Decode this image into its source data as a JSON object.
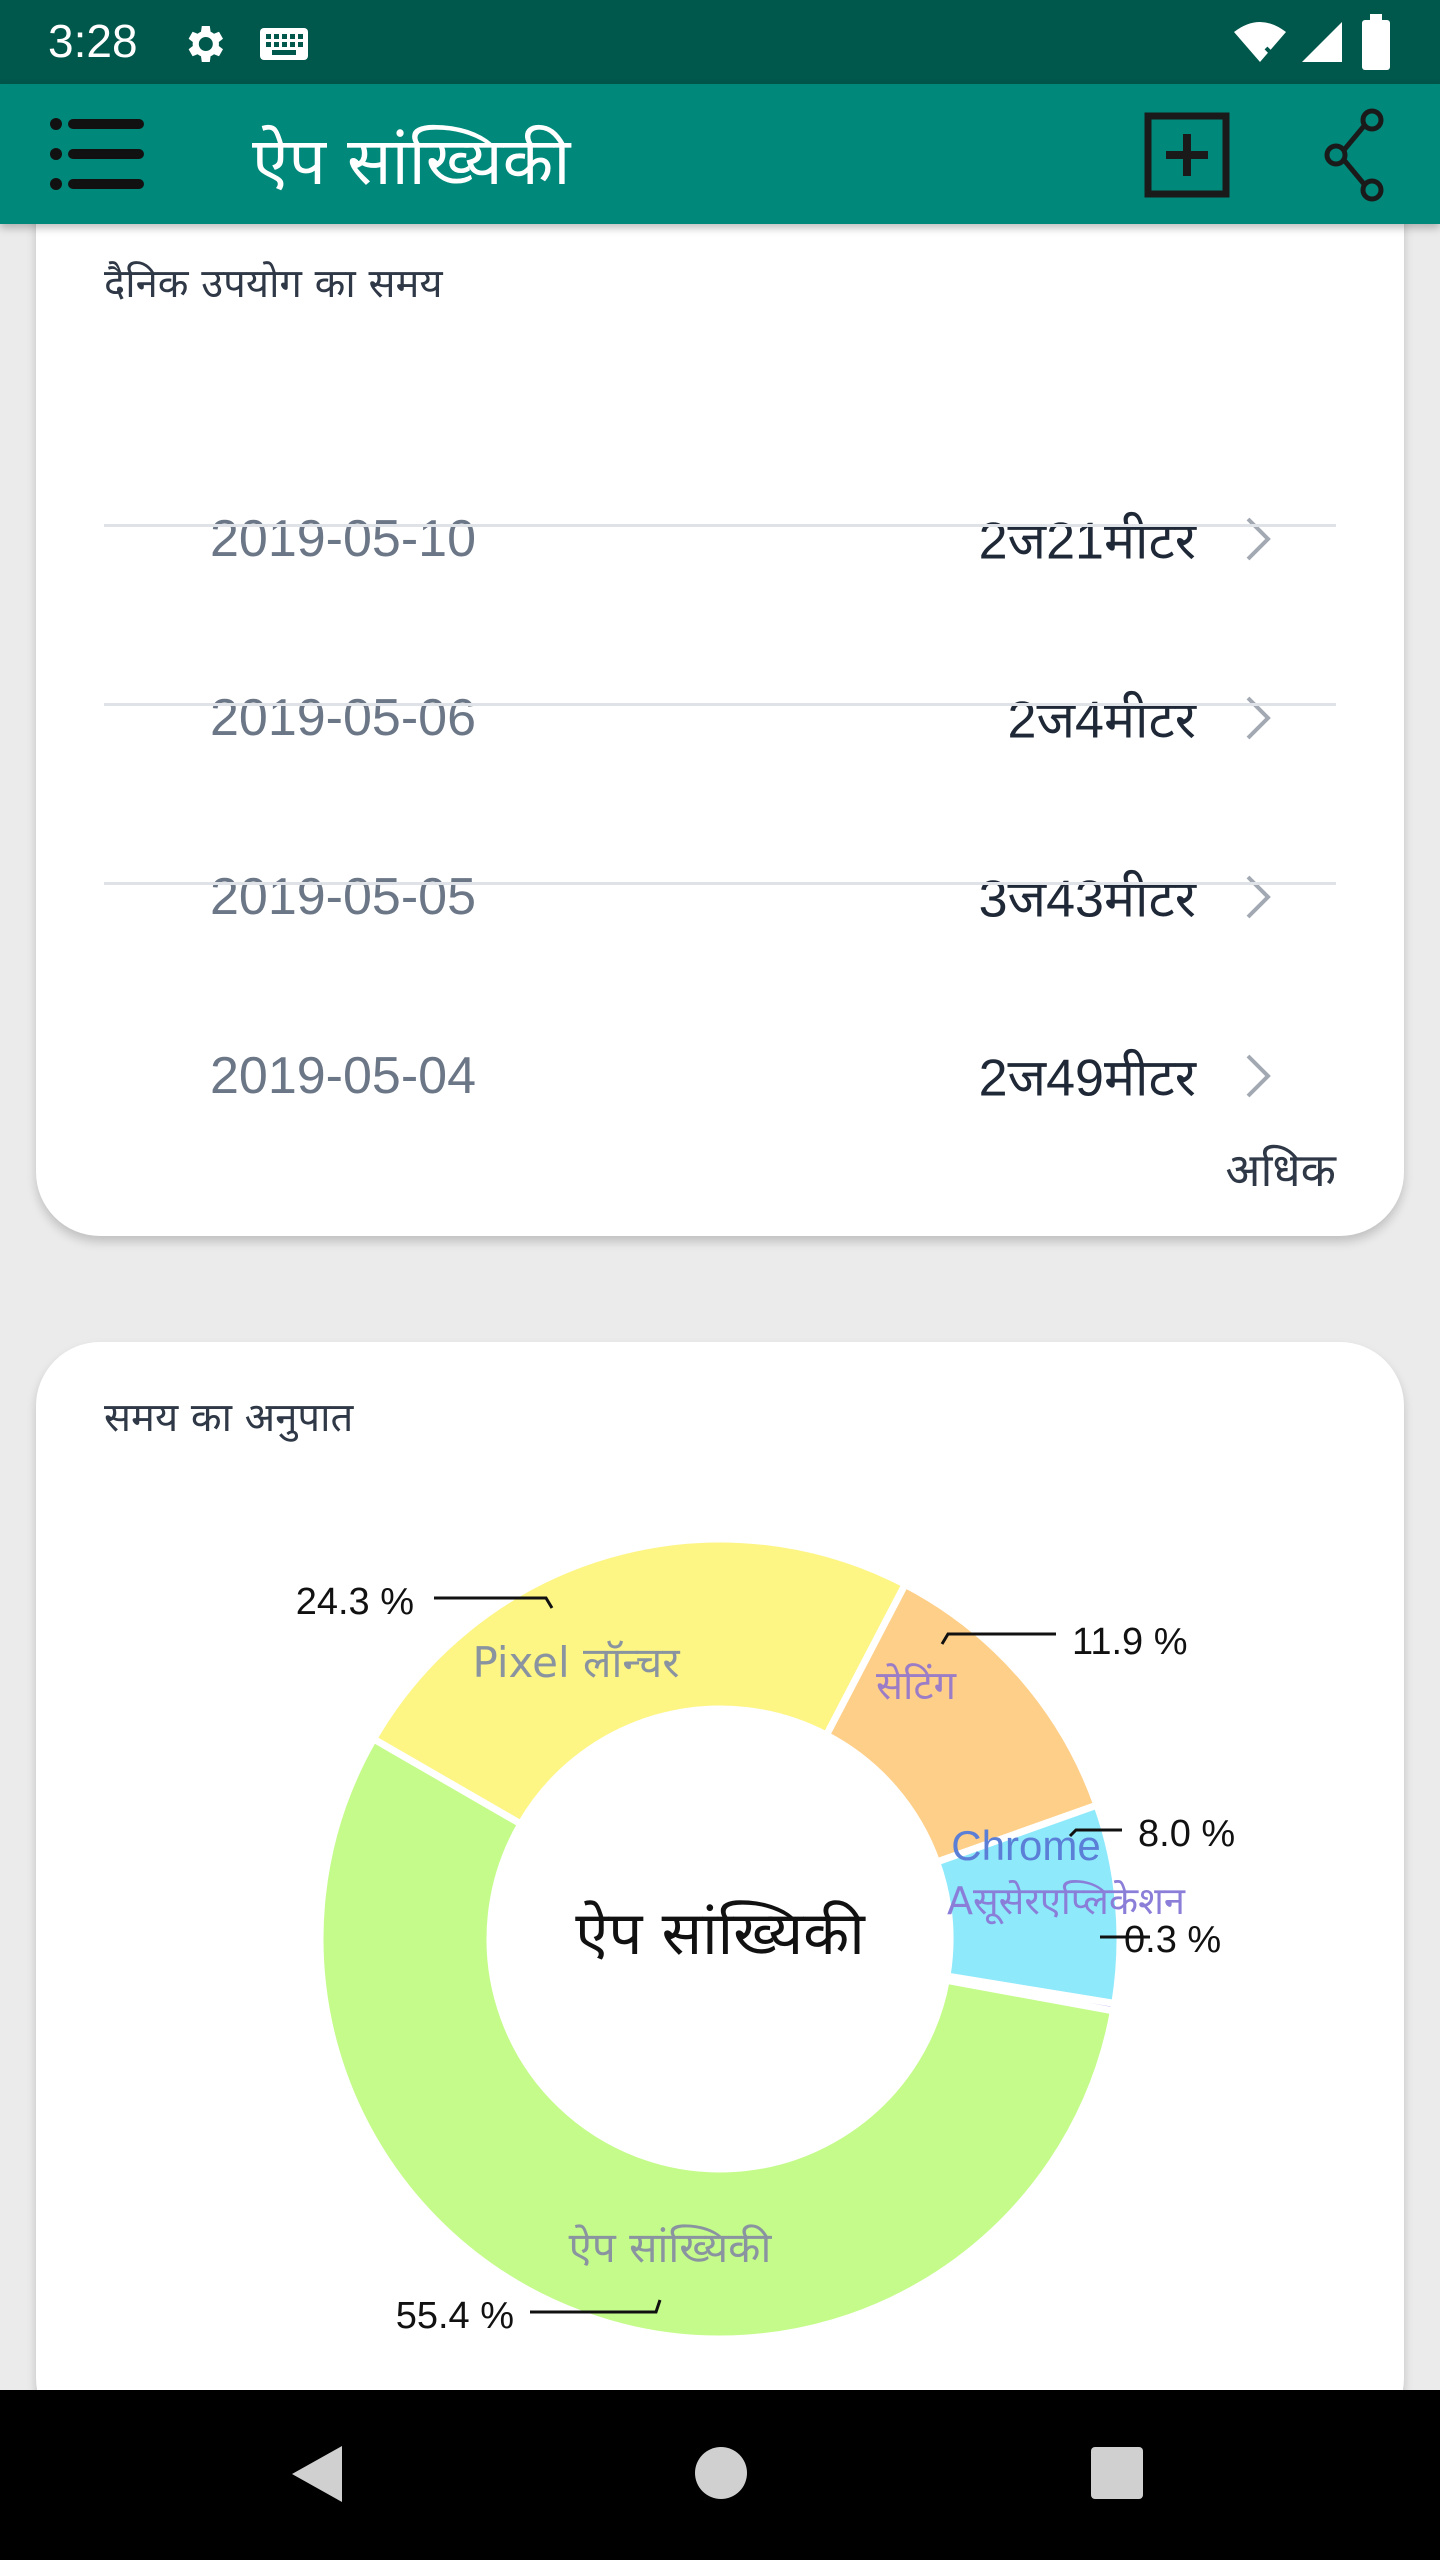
{
  "status_bar": {
    "time": "3:28",
    "icons": [
      "settings-icon",
      "keyboard-icon",
      "wifi-icon",
      "signal-icon",
      "battery-icon"
    ],
    "background": "#00574b"
  },
  "app_bar": {
    "title": "ऐप सांख्यिकी",
    "menu_icon": "menu-icon",
    "add_icon": "add-box-icon",
    "share_icon": "share-icon",
    "background": "#00897b"
  },
  "daily_usage": {
    "title": "दैनिक उपयोग का समय",
    "rows": [
      {
        "date": "2019-05-10",
        "duration": "2ज21मीटर"
      },
      {
        "date": "2019-05-06",
        "duration": "2ज4मीटर"
      },
      {
        "date": "2019-05-05",
        "duration": "3ज43मीटर"
      },
      {
        "date": "2019-05-04",
        "duration": "2ज49मीटर"
      }
    ],
    "more_label": "अधिक"
  },
  "time_ratio": {
    "title": "समय का अनुपात",
    "center_label": "ऐप सांख्यिकी",
    "small_labels": "Aसूसेरएप्लिकेशन",
    "small_percent": "0.3 %",
    "chart_data": {
      "type": "pie",
      "title": "",
      "slices": [
        {
          "name": "ऐप सांख्यिकी",
          "value": 55.4,
          "label": "55.4 %",
          "color": "#c5fb8a"
        },
        {
          "name": "Pixel लॉन्चर",
          "value": 24.3,
          "label": "24.3 %",
          "color": "#fdf584"
        },
        {
          "name": "सेटिंग",
          "value": 11.9,
          "label": "11.9 %",
          "color": "#fecf88"
        },
        {
          "name": "Chrome",
          "value": 8.0,
          "label": "8.0 %",
          "color": "#8ee9fb"
        },
        {
          "name": "Aसूसेरएप्लिकेशन",
          "value": 0.3,
          "label": "0.3 %",
          "color": "#b3a3f5"
        }
      ]
    }
  },
  "nav_bar": {
    "icons": [
      "back-icon",
      "home-icon",
      "recents-icon"
    ]
  }
}
